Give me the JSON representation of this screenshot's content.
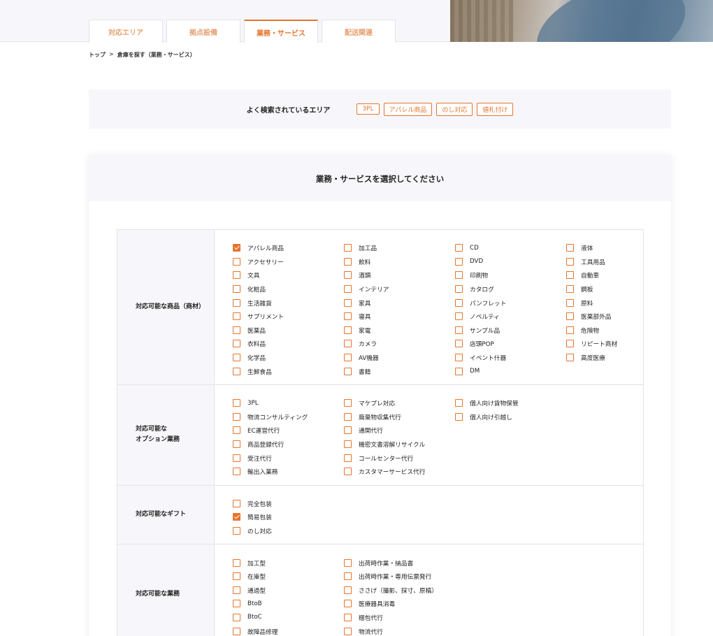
{
  "tabs": [
    {
      "label": "対応エリア",
      "active": false
    },
    {
      "label": "拠点設備",
      "active": false
    },
    {
      "label": "業務・サービス",
      "active": true
    },
    {
      "label": "配送関連",
      "active": false
    }
  ],
  "breadcrumb": {
    "home": "トップ",
    "separator": ">",
    "current": "倉庫を探す（業務・サービス）"
  },
  "popular": {
    "label": "よく検索されているエリア",
    "chips": [
      "3PL",
      "アパレル商品",
      "のし対応",
      "値札付け"
    ]
  },
  "card": {
    "title": "業務・サービスを選択してください"
  },
  "colors": {
    "accent": "#e5752e",
    "panel": "#f7f7fb",
    "border": "#e2e2ea"
  },
  "icons": {
    "checkbox": "checkbox-icon",
    "check": "check-icon"
  },
  "sections": [
    {
      "label": "対応可能な商品（商材）",
      "columns": [
        [
          {
            "label": "アパレル商品",
            "checked": true
          },
          {
            "label": "アクセサリー",
            "checked": false
          },
          {
            "label": "文具",
            "checked": false
          },
          {
            "label": "化粧品",
            "checked": false
          },
          {
            "label": "生活雑貨",
            "checked": false
          },
          {
            "label": "サプリメント",
            "checked": false
          },
          {
            "label": "医薬品",
            "checked": false
          },
          {
            "label": "衣料品",
            "checked": false
          },
          {
            "label": "化学品",
            "checked": false
          },
          {
            "label": "生鮮食品",
            "checked": false
          }
        ],
        [
          {
            "label": "加工品",
            "checked": false
          },
          {
            "label": "飲料",
            "checked": false
          },
          {
            "label": "酒類",
            "checked": false
          },
          {
            "label": "インテリア",
            "checked": false
          },
          {
            "label": "家具",
            "checked": false
          },
          {
            "label": "寝具",
            "checked": false
          },
          {
            "label": "家電",
            "checked": false
          },
          {
            "label": "カメラ",
            "checked": false
          },
          {
            "label": "AV機器",
            "checked": false
          },
          {
            "label": "書籍",
            "checked": false
          }
        ],
        [
          {
            "label": "CD",
            "checked": false
          },
          {
            "label": "DVD",
            "checked": false
          },
          {
            "label": "印刷物",
            "checked": false
          },
          {
            "label": "カタログ",
            "checked": false
          },
          {
            "label": "パンフレット",
            "checked": false
          },
          {
            "label": "ノベルティ",
            "checked": false
          },
          {
            "label": "サンプル品",
            "checked": false
          },
          {
            "label": "店頭POP",
            "checked": false
          },
          {
            "label": "イベント什器",
            "checked": false
          },
          {
            "label": "DM",
            "checked": false
          }
        ],
        [
          {
            "label": "液体",
            "checked": false
          },
          {
            "label": "工具用品",
            "checked": false
          },
          {
            "label": "自動車",
            "checked": false
          },
          {
            "label": "鋼板",
            "checked": false
          },
          {
            "label": "原料",
            "checked": false
          },
          {
            "label": "医薬部外品",
            "checked": false
          },
          {
            "label": "危険物",
            "checked": false
          },
          {
            "label": "リピート商材",
            "checked": false
          },
          {
            "label": "高度医療",
            "checked": false
          }
        ]
      ]
    },
    {
      "label": "対応可能な\nオプション業務",
      "columns": [
        [
          {
            "label": "3PL",
            "checked": false
          },
          {
            "label": "物流コンサルティング",
            "checked": false
          },
          {
            "label": "EC運営代行",
            "checked": false
          },
          {
            "label": "商品登録代行",
            "checked": false
          },
          {
            "label": "受注代行",
            "checked": false
          },
          {
            "label": "輸出入業務",
            "checked": false
          }
        ],
        [
          {
            "label": "マケプレ対応",
            "checked": false
          },
          {
            "label": "廃棄物収集代行",
            "checked": false
          },
          {
            "label": "通関代行",
            "checked": false
          },
          {
            "label": "機密文書溶解リサイクル",
            "checked": false
          },
          {
            "label": "コールセンター代行",
            "checked": false
          },
          {
            "label": "カスタマーサービス代行",
            "checked": false
          }
        ],
        [
          {
            "label": "個人向け貨物保管",
            "checked": false
          },
          {
            "label": "個人向け引越し",
            "checked": false
          }
        ],
        []
      ]
    },
    {
      "label": "対応可能なギフト",
      "columns": [
        [
          {
            "label": "完全包装",
            "checked": false
          },
          {
            "label": "簡易包装",
            "checked": true
          },
          {
            "label": "のし対応",
            "checked": false
          }
        ],
        [],
        [],
        []
      ]
    },
    {
      "label": "対応可能な業務",
      "columns": [
        [
          {
            "label": "加工型",
            "checked": false
          },
          {
            "label": "在庫型",
            "checked": false
          },
          {
            "label": "通過型",
            "checked": false
          },
          {
            "label": "BtoB",
            "checked": false
          },
          {
            "label": "BtoC",
            "checked": false
          },
          {
            "label": "故障品修理",
            "checked": false
          }
        ],
        [
          {
            "label": "出荷時作業・納品書",
            "checked": false
          },
          {
            "label": "出荷時作業・専用伝票発行",
            "checked": false
          },
          {
            "label": "ささげ（撮影、採寸、原稿）",
            "checked": false
          },
          {
            "label": "医療器具消毒",
            "checked": false
          },
          {
            "label": "梱包代行",
            "checked": false
          },
          {
            "label": "物流代行",
            "checked": false
          }
        ],
        [],
        []
      ]
    }
  ]
}
